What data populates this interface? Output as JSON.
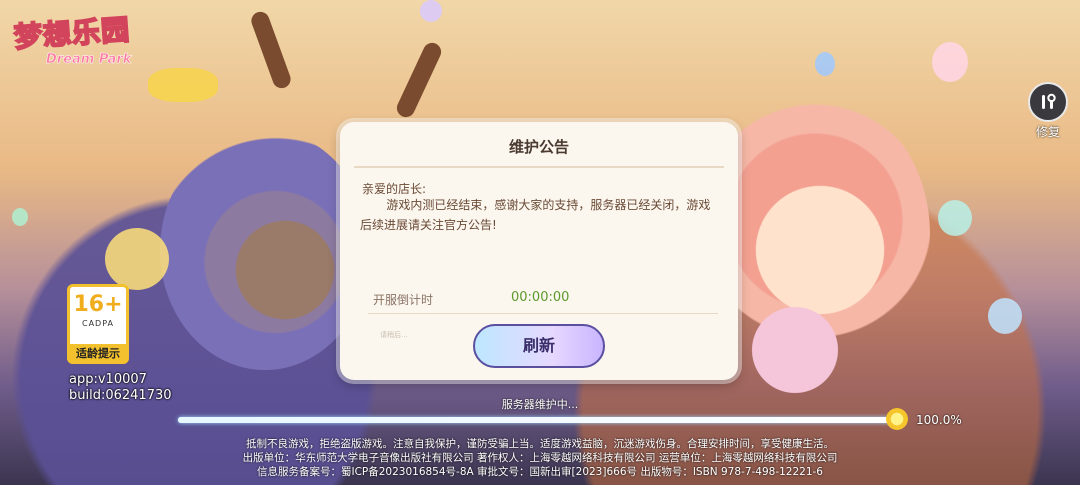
{
  "logo": {
    "title": "梦想乐园",
    "subtitle": "Dream Park"
  },
  "repair": {
    "label": "修复",
    "icon": "wrench-icon"
  },
  "age_rating": {
    "age": "16+",
    "org": "CADPA",
    "text": "适龄提示"
  },
  "build_info": {
    "app": "app:v10007",
    "build": "build:06241730"
  },
  "dialog": {
    "title": "维护公告",
    "greeting": "亲爱的店长:",
    "body": "游戏内测已经结束，感谢大家的支持，服务器已经关闭，游戏后续进展请关注官方公告!",
    "countdown_label": "开服倒计时",
    "countdown_value": "00:00:00",
    "faint_text": "请稍后...",
    "refresh_label": "刷新"
  },
  "status": {
    "text": "服务器维护中...",
    "progress": 1.0,
    "percent_label": "100.0%"
  },
  "footer": {
    "line1": "抵制不良游戏，拒绝盗版游戏。注意自我保护，谨防受骗上当。适度游戏益脑，沉迷游戏伤身。合理安排时间，享受健康生活。",
    "line2": "出版单位：华东师范大学电子音像出版社有限公司 著作权人：上海零越网络科技有限公司 运营单位：上海零越网络科技有限公司",
    "line3": "信息服务备案号：蜀ICP备2023016854号-8A 审批文号：国新出审[2023]666号 出版物号：ISBN 978-7-498-12221-6"
  },
  "colors": {
    "countdown": "#5c9a2c",
    "age_badge": "#f3c12e",
    "dialog_bg": "#fbf6ee"
  }
}
